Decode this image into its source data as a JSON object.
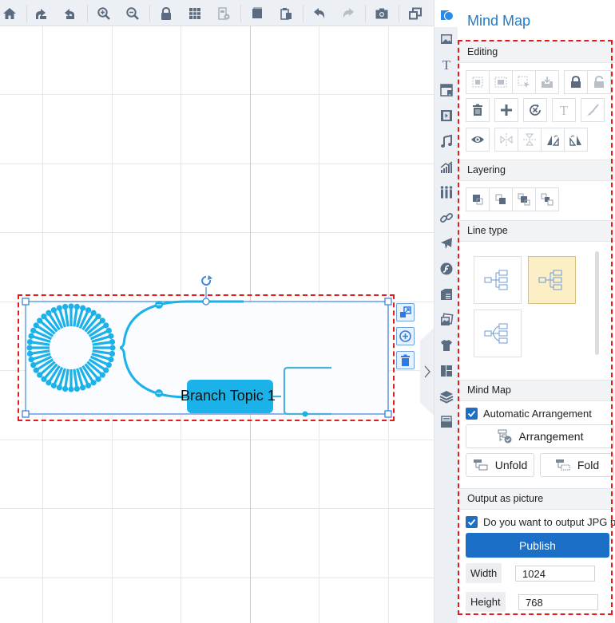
{
  "toolbar": {
    "buttons": [
      {
        "name": "home-icon",
        "label": "Home"
      },
      {
        "name": "redo-branch-icon",
        "label": "Forward"
      },
      {
        "name": "undo-branch-icon",
        "label": "Back"
      },
      {
        "name": "zoom-in-icon",
        "label": "Zoom in"
      },
      {
        "name": "zoom-out-icon",
        "label": "Zoom out"
      },
      {
        "name": "lock-icon",
        "label": "Lock"
      },
      {
        "name": "grid-icon",
        "label": "Grid"
      },
      {
        "name": "settings-doc-icon",
        "label": "Settings"
      },
      {
        "name": "copy-icon",
        "label": "Copy"
      },
      {
        "name": "paste-icon",
        "label": "Paste"
      },
      {
        "name": "undo-icon",
        "label": "Undo"
      },
      {
        "name": "redo-icon",
        "label": "Redo"
      },
      {
        "name": "camera-icon",
        "label": "Screenshot"
      },
      {
        "name": "window-icon",
        "label": "Window"
      }
    ]
  },
  "canvas": {
    "branch_topic_label": "Branch Topic 1",
    "colors": {
      "mindmap": "#1ab2e8",
      "selection": "#3d86d8",
      "annotation": "#e31b1b"
    }
  },
  "rail": {
    "items": [
      "mindmap-icon",
      "image-icon",
      "text-icon",
      "banner-icon",
      "video-icon",
      "music-icon",
      "chart-icon",
      "people-icon",
      "link-icon",
      "airplane-icon",
      "flash-icon",
      "document-list-icon",
      "gallery-icon",
      "tshirt-icon",
      "layout-icon",
      "layers-icon",
      "archive-icon"
    ]
  },
  "panel": {
    "title": "Mind Map",
    "sections": {
      "editing": "Editing",
      "layering": "Layering",
      "line_type": "Line type",
      "mind_map": "Mind Map",
      "output": "Output as picture"
    },
    "editing_buttons": [
      [
        "group",
        "ungroup",
        "select-group",
        "import",
        "lock",
        "unlock"
      ],
      [
        "delete",
        "add",
        "reset",
        "text",
        "brush"
      ],
      [
        "visibility",
        "flip-horizontal",
        "flip-vertical",
        "rotate-left",
        "rotate-right"
      ]
    ],
    "layering_buttons": [
      "bring-to-front",
      "send-to-back",
      "bring-forward",
      "send-backward"
    ],
    "line_types": [
      {
        "name": "straight",
        "selected": false
      },
      {
        "name": "elbow",
        "selected": true
      },
      {
        "name": "curved",
        "selected": false
      }
    ],
    "auto_arrangement": {
      "label": "Automatic Arrangement",
      "checked": true
    },
    "arrangement_label": "Arrangement",
    "unfold_label": "Unfold",
    "fold_label": "Fold",
    "output_jpg": {
      "label": "Do you want to output JPG p",
      "checked": true
    },
    "publish_label": "Publish",
    "width_label": "Width",
    "width_value": "1024",
    "height_label": "Height",
    "height_value": "768"
  }
}
